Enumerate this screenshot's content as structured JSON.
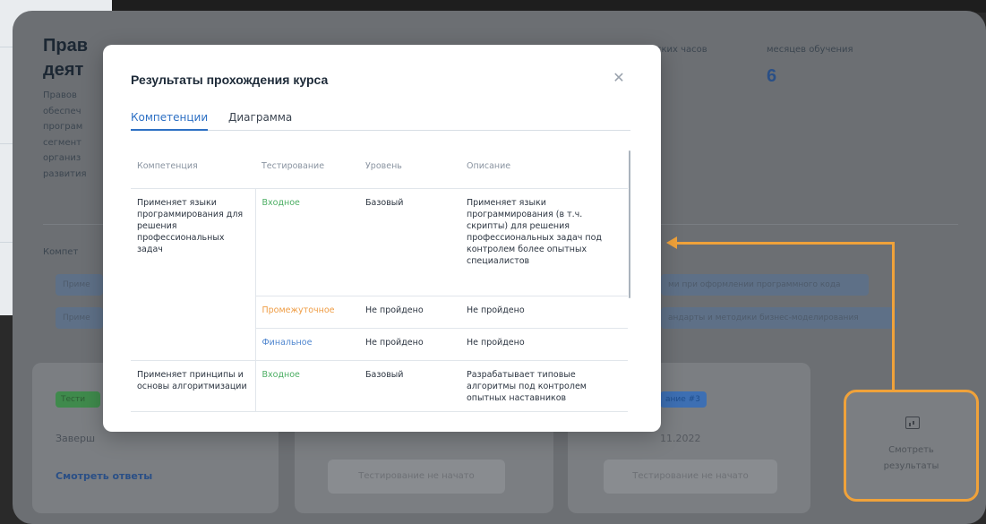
{
  "background": {
    "title": "Прав\nдеят",
    "desc": "Правов обеспеч програм сегмент организ развития",
    "stat_hours_label": "ских часов",
    "stat_months_label": "месяцев обучения",
    "stat_months_value": "6",
    "competencies_label": "Компет",
    "chips": [
      "Приме",
      "Приме",
      "ми при оформлении программного кода",
      "андарты и методики бизнес-моделирования"
    ],
    "test_badge": "Тести",
    "finish_label": "Заверш",
    "answers_link": "Смотреть ответы",
    "badge_right": "ание #3",
    "date_right": "11.2022",
    "disabled_btn_1": "Тестирование не начато",
    "disabled_btn_2": "Тестирование не начато",
    "results_label_1": "Смотреть",
    "results_label_2": "результаты",
    "results_icon": "chart-icon"
  },
  "modal": {
    "title": "Результаты прохождения курса",
    "close_icon": "close-icon",
    "tabs": [
      {
        "label": "Компетенции",
        "active": true
      },
      {
        "label": "Диаграмма",
        "active": false
      }
    ],
    "table": {
      "headers": [
        "Компетенция",
        "Тестирование",
        "Уровень",
        "Описание"
      ],
      "groups": [
        {
          "competency": "Применяет языки программирования для решения профессиональных задач",
          "rows": [
            {
              "testing": "Входное",
              "level": "Базовый",
              "description": "Применяет языки программирования (в т.ч. скрипты) для решения профессиональных задач под контролем более опытных специалистов"
            },
            {
              "testing": "Промежуточное",
              "level": "Не пройдено",
              "description": "Не пройдено"
            },
            {
              "testing": "Финальное",
              "level": "Не пройдено",
              "description": "Не пройдено"
            }
          ]
        },
        {
          "competency": "Применяет принципы и основы алгоритмизации",
          "rows": [
            {
              "testing": "Входное",
              "level": "Базовый",
              "description": "Разрабатывает типовые алгоритмы под контролем опытных наставников"
            }
          ]
        }
      ]
    }
  },
  "colors": {
    "accent": "#2d70c4",
    "input": "#4cae63",
    "intermediate": "#ef9d45",
    "final": "#4f86cf",
    "annotation": "#f0a23a"
  }
}
